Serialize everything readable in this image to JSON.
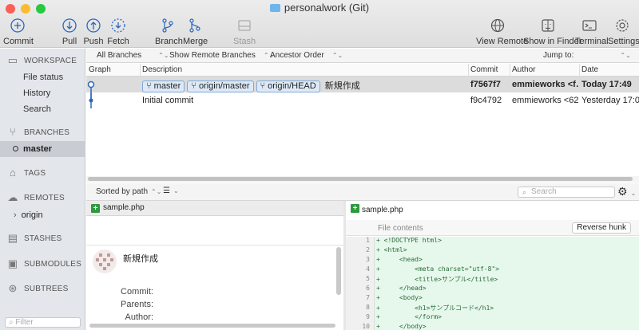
{
  "window": {
    "title": "personalwork (Git)"
  },
  "toolbar": {
    "commit": "Commit",
    "pull": "Pull",
    "push": "Push",
    "fetch": "Fetch",
    "branch": "Branch",
    "merge": "Merge",
    "stash": "Stash",
    "view_remote": "View Remote",
    "show_in_finder": "Show in Finder",
    "terminal": "Terminal",
    "settings": "Settings"
  },
  "sidebar": {
    "workspace": "WORKSPACE",
    "workspace_items": [
      "File status",
      "History",
      "Search"
    ],
    "branches": "BRANCHES",
    "branch_items": [
      "master"
    ],
    "tags": "TAGS",
    "remotes": "REMOTES",
    "remote_items": [
      "origin"
    ],
    "stashes": "STASHES",
    "submodules": "SUBMODULES",
    "subtrees": "SUBTREES",
    "filter_placeholder": "Filter"
  },
  "history_bar": {
    "branches_select": "All Branches",
    "remote_select": "Show Remote Branches",
    "order_select": "Ancestor Order",
    "jump_to": "Jump to:"
  },
  "columns": {
    "graph": "Graph",
    "description": "Description",
    "commit": "Commit",
    "author": "Author",
    "date": "Date"
  },
  "commits": [
    {
      "badges": [
        "master",
        "origin/master",
        "origin/HEAD"
      ],
      "message": "新規作成",
      "hash": "f7567f7",
      "author": "emmieworks <f…",
      "date": "Today 17:49"
    },
    {
      "badges": [],
      "message": "Initial commit",
      "hash": "f9c4792",
      "author": "emmieworks <62…",
      "date": "Yesterday 17:07"
    }
  ],
  "file_bar": {
    "sort": "Sorted by path",
    "search_placeholder": "Search"
  },
  "file_list": [
    {
      "name": "sample.php"
    }
  ],
  "commit_detail": {
    "message": "新規作成",
    "labels": [
      "Commit:",
      "Parents:",
      "Author:"
    ]
  },
  "diff": {
    "file": "sample.php",
    "header": "File contents",
    "reverse_button": "Reverse hunk",
    "lines": [
      {
        "n": "1",
        "text": "+ <!DOCTYPE html>"
      },
      {
        "n": "2",
        "text": "+ <html>"
      },
      {
        "n": "3",
        "text": "+     <head>"
      },
      {
        "n": "4",
        "text": "+         <meta charset=\"utf-8\">"
      },
      {
        "n": "5",
        "text": "+         <title>サンプル</title>"
      },
      {
        "n": "6",
        "text": "+     </head>"
      },
      {
        "n": "7",
        "text": "+     <body>"
      },
      {
        "n": "8",
        "text": "+         <h1>サンプルコード</h1>"
      },
      {
        "n": "9",
        "text": "+         </form>"
      },
      {
        "n": "10",
        "text": "+     </body>"
      }
    ]
  },
  "colors": {
    "accent": "#2a66c0",
    "selected_row": "#dcdcdc",
    "diff_add": "#e6f7ec"
  }
}
